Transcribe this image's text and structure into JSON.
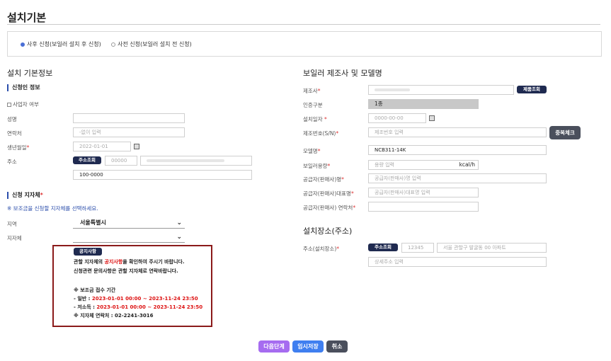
{
  "page_title": "설치기본",
  "apply_type": {
    "options": [
      {
        "label": "사후 신청(보일러 설치 후 신청)",
        "checked": true
      },
      {
        "label": "사전 신청(보일러 설치 전 신청)",
        "checked": false
      }
    ]
  },
  "left": {
    "section_title": "설치 기본정보",
    "applicant_title": "신청인 정보",
    "business_check": "사업자 여부",
    "fields": {
      "name_label": "성명",
      "phone_label": "연락처",
      "phone_placeholder": "-없이 입력",
      "birth_label": "생년월일",
      "birth_placeholder": "2022-01-01",
      "address_label": "주소",
      "address_search_btn": "주소조회",
      "address_zip": "00000",
      "address_detail": "100-0000"
    },
    "region_title": "신청 지자체",
    "region_note": "※ 보조금을 신청할 지자체를 선택하세요.",
    "region_label": "지역",
    "region_value": "서울특별시",
    "local_label": "지자체",
    "local_value": ""
  },
  "notice": {
    "badge": "공지사항",
    "line1_pre": "관할 지자체의 ",
    "line1_red": "공지사항",
    "line1_post": "을 확인하여 주시기 바랍니다.",
    "line2": "신청관련 문의사항은 관할 지자체로 연락바랍니다.",
    "period_title": "※ 보조금 접수 기간",
    "general_label": "- 일반 : ",
    "general_period": "2023-01-01 00:00 ~ 2023-11-24 23:50",
    "low_label": "- 저소득 : ",
    "low_period": "2023-01-01 00:00 ~ 2023-11-24 23:50",
    "contact": "※ 지자체 연락처 : 02-2241-3016"
  },
  "right": {
    "section_title": "보일러 제조사 및 모델명",
    "maker_label": "제조사",
    "maker_search_btn": "제품조회",
    "cert_label": "인증구분",
    "cert_value": "1종",
    "install_date_label": "설치일자 ",
    "install_date_value": "0000-00-00",
    "serial_label": "제조번호(S/N)",
    "serial_placeholder": "제조번호 입력",
    "dup_check_btn": "중복체크",
    "model_label": "모델명",
    "model_value": "NCB311-14K",
    "capacity_label": "보일러용량",
    "capacity_placeholder": "용량 입력",
    "capacity_unit": "kcal/h",
    "supplier_name_label": "공급자(판매사)명",
    "supplier_name_placeholder": "공급자(판매사)명 입력",
    "supplier_ceo_label": "공급자(판매사)대표명",
    "supplier_ceo_placeholder": "공급자(판매사)대표명 입력",
    "supplier_phone_label": "공급자(판매사) 연락처",
    "location_title": "설치장소(주소)",
    "location_label": "주소(설치장소)",
    "location_search_btn": "주소조회",
    "location_zip": "12345",
    "location_addr": "서울 관할구 발굴동 00 아파트",
    "location_detail_placeholder": "상세주소 입력"
  },
  "footer": {
    "next_btn": "다음단계",
    "save_btn": "임시저장",
    "cancel_btn": "취소",
    "colors": {
      "next": "#a66cf0",
      "save": "#3f7ff0",
      "cancel": "#4a4f5c"
    }
  },
  "colors": {
    "navy": "#1f2a50",
    "accent": "#2b4eab",
    "notice_border": "#8b1a1a",
    "red": "#d11111"
  }
}
